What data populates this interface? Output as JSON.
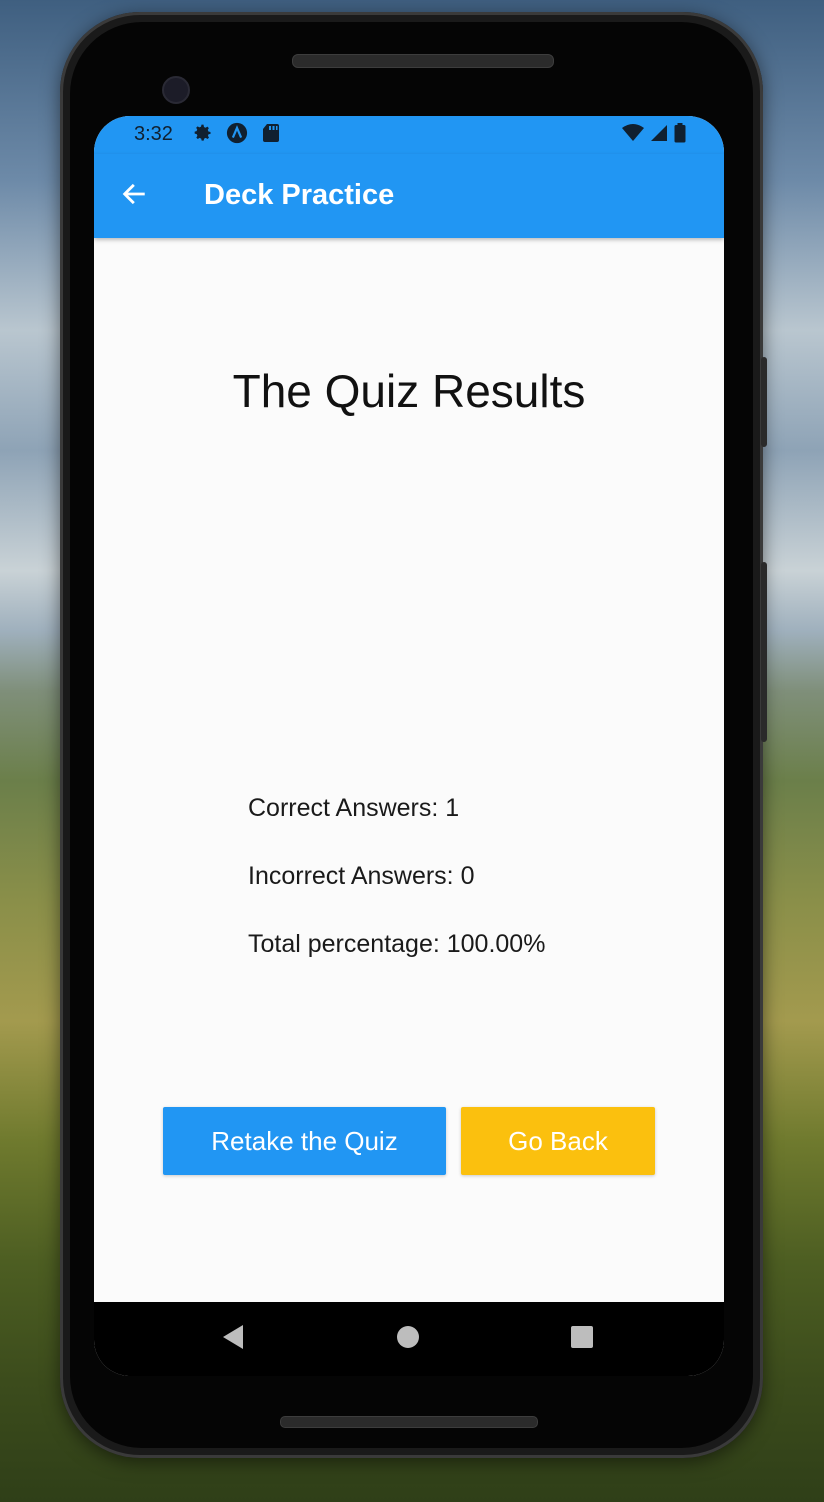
{
  "status_bar": {
    "time": "3:32",
    "left_icons": [
      "gear-icon",
      "app-a-icon",
      "sd-card-icon"
    ],
    "right_icons": [
      "wifi-icon",
      "signal-icon",
      "battery-icon"
    ]
  },
  "app_bar": {
    "title": "Deck Practice",
    "back_icon": "arrow-left-icon"
  },
  "results": {
    "heading": "The Quiz Results",
    "correct": "Correct Answers: 1",
    "incorrect": "Incorrect Answers: 0",
    "percentage": "Total percentage: 100.00%"
  },
  "actions": {
    "retake_label": "Retake the Quiz",
    "go_back_label": "Go Back"
  },
  "nav_bar": {
    "icons": [
      "back-triangle-icon",
      "home-circle-icon",
      "recents-square-icon"
    ]
  },
  "colors": {
    "primary": "#2196f3",
    "accent": "#fbc00e",
    "background": "#fbfbfb"
  }
}
